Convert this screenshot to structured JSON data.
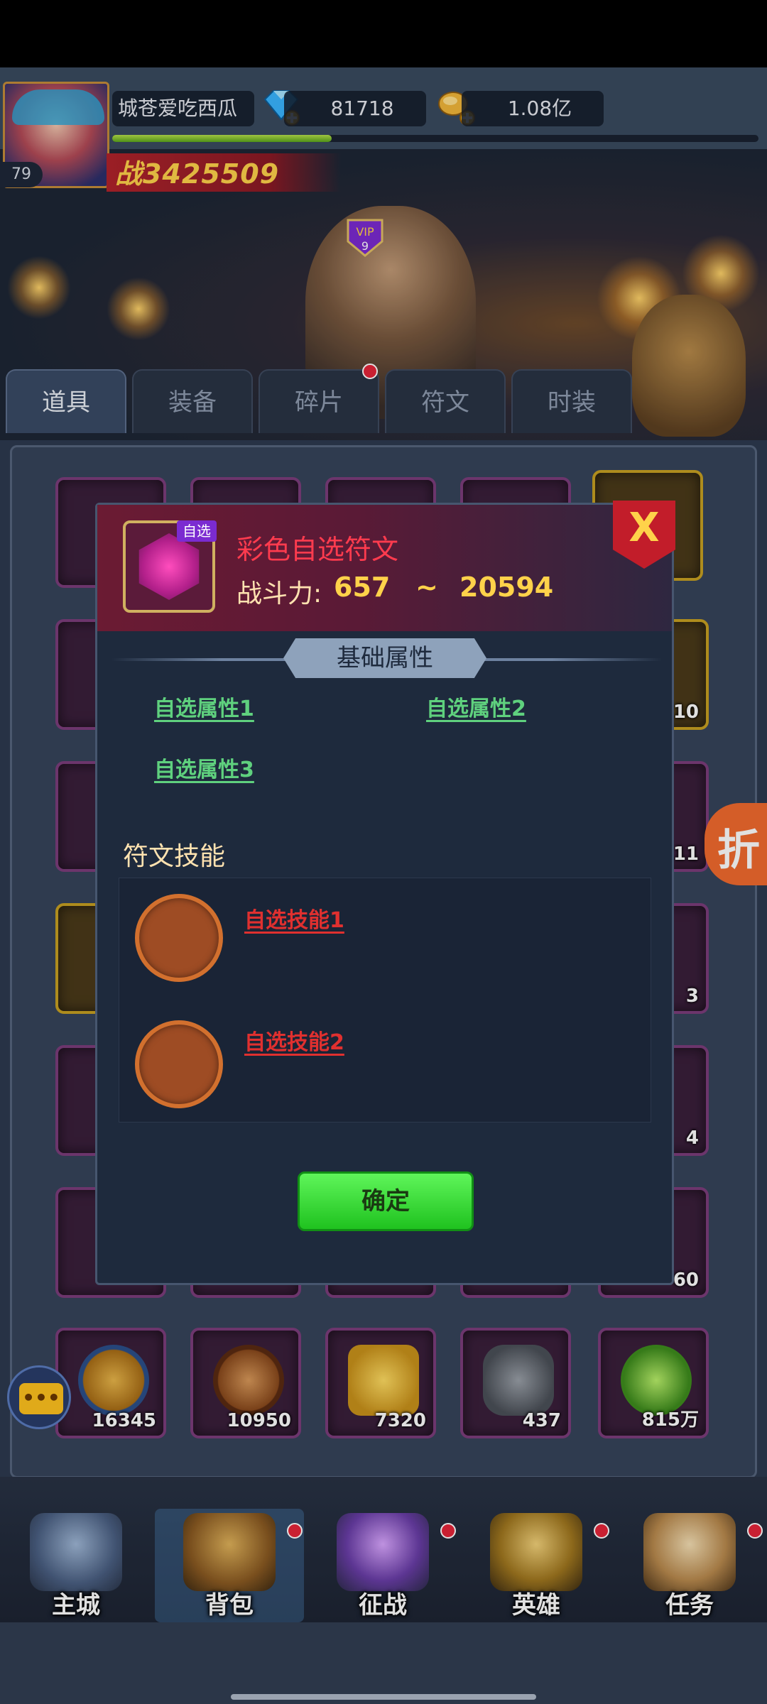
{
  "player": {
    "name": "城苍爱吃西瓜",
    "level": "79",
    "gems": "81718",
    "gold": "1.08亿",
    "battle_power": "战3425509",
    "vip": "VIP 9",
    "xp_progress": 0.34
  },
  "tabs": [
    {
      "label": "道具",
      "active": true
    },
    {
      "label": "装备",
      "active": false
    },
    {
      "label": "碎片",
      "active": false,
      "badge": true
    },
    {
      "label": "符文",
      "active": false
    },
    {
      "label": "时装",
      "active": false
    }
  ],
  "inventory": {
    "visible_quantities": [
      "10",
      "11",
      "3",
      "4",
      "60",
      "16345",
      "10950",
      "7320",
      "437",
      "815万"
    ]
  },
  "dialog": {
    "item_tag": "自选",
    "item_title": "彩色自选符文",
    "power_label": "战斗力:",
    "power_min": "657",
    "power_sep": "~",
    "power_max": "20594",
    "close_label": "X",
    "section_basic": "基础属性",
    "attributes": [
      "自选属性1",
      "自选属性2",
      "自选属性3"
    ],
    "skills_title": "符文技能",
    "skills": [
      "自选技能1",
      "自选技能2"
    ],
    "confirm_label": "确定"
  },
  "nav": [
    {
      "label": "主城",
      "active": false
    },
    {
      "label": "背包",
      "active": true
    },
    {
      "label": "征战",
      "active": false
    },
    {
      "label": "英雄",
      "active": false
    },
    {
      "label": "任务",
      "active": false
    }
  ],
  "floats": {
    "discount_label": "折",
    "chat_label": "•••"
  },
  "colors": {
    "title_red": "#ff3b4e",
    "attr_green": "#5fd17e",
    "skill_red": "#e0302f",
    "confirm_green": "#1fc21f",
    "power_gold": "#ffd24a"
  }
}
